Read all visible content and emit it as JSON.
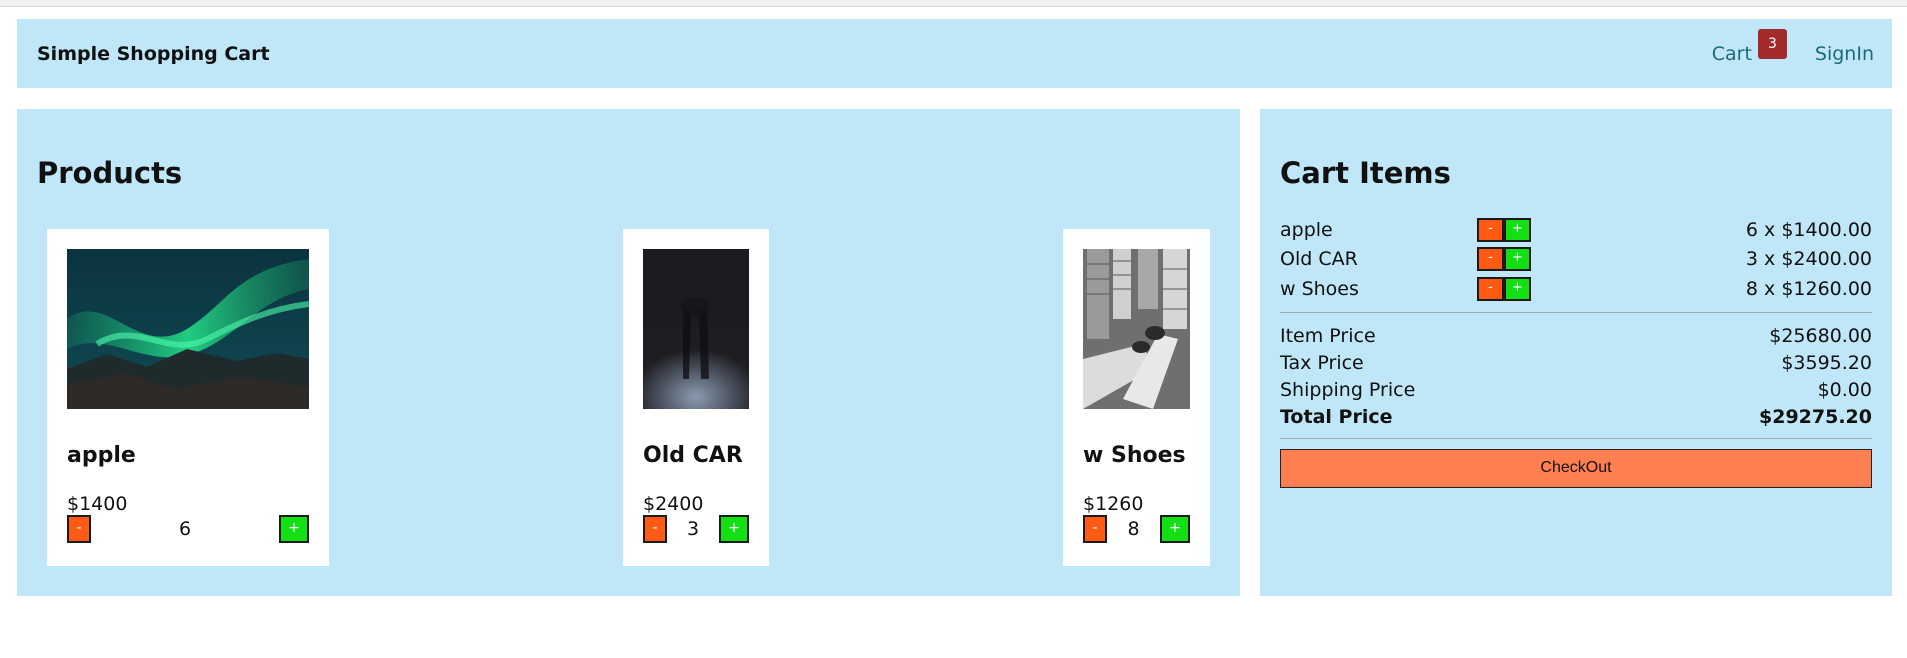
{
  "header": {
    "brand": "Simple Shopping Cart",
    "cart_label": "Cart",
    "cart_count": "3",
    "signin_label": "SignIn"
  },
  "products": {
    "heading": "Products",
    "items": [
      {
        "name": "apple",
        "price": "$1400",
        "qty": "6",
        "image_icon": "aurora-image",
        "minus": "-",
        "plus": "+"
      },
      {
        "name": "Old CAR",
        "price": "$2400",
        "qty": "3",
        "image_icon": "dark-figure-image",
        "minus": "-",
        "plus": "+"
      },
      {
        "name": "w Shoes",
        "price": "$1260",
        "qty": "8",
        "image_icon": "shoes-city-image",
        "minus": "-",
        "plus": "+"
      }
    ]
  },
  "cart": {
    "heading": "Cart Items",
    "items": [
      {
        "name": "apple",
        "amount": "6 x $1400.00",
        "minus": "-",
        "plus": "+"
      },
      {
        "name": "Old CAR",
        "amount": "3 x $2400.00",
        "minus": "-",
        "plus": "+"
      },
      {
        "name": "w Shoes",
        "amount": "8 x $1260.00",
        "minus": "-",
        "plus": "+"
      }
    ],
    "summary": {
      "item_price_label": "Item Price",
      "item_price": "$25680.00",
      "tax_price_label": "Tax Price",
      "tax_price": "$3595.20",
      "shipping_price_label": "Shipping Price",
      "shipping_price": "$0.00",
      "total_price_label": "Total Price",
      "total_price": "$29275.20"
    },
    "checkout_label": "CheckOut"
  },
  "colors": {
    "panel_bg": "#bfe7f7",
    "minus_btn": "#ff5a14",
    "plus_btn": "#12e014",
    "checkout_btn": "#ff7f50",
    "badge": "#a32a2a",
    "link": "#1c6a77"
  }
}
